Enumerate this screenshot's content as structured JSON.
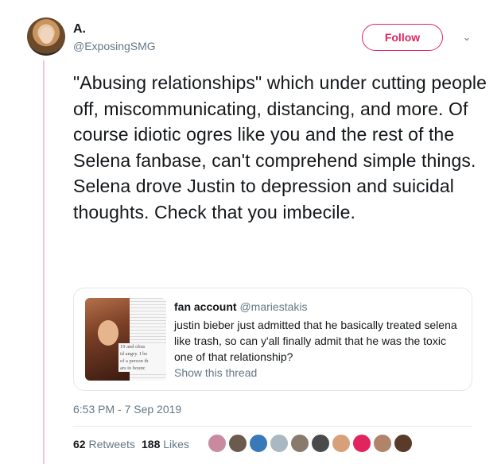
{
  "author": {
    "display_name": "A.",
    "handle": "@ExposingSMG"
  },
  "follow_button": "Follow",
  "tweet_text": "\"Abusing relationships\" which under cutting people off, miscommunicating, distancing, and more. Of course idiotic ogres like you and the rest of the Selena fanbase, can't comprehend simple things. Selena drove Justin to depression and suicidal thoughts. Check that you imbecile.",
  "quoted_tweet": {
    "author_name": "fan account",
    "author_handle": "@mariestakis",
    "text": "justin bieber just admitted that he basically treated selena like trash, so can y'all finally admit that he was the toxic one of that relationship?",
    "show_thread": "Show this thread",
    "image_text": "19 and obus\nid angry. I be\nof a person th\nars to bounc"
  },
  "timestamp": "6:53 PM - 7 Sep 2019",
  "stats": {
    "retweets_count": "62",
    "retweets_label": "Retweets",
    "likes_count": "188",
    "likes_label": "Likes"
  },
  "likers": [
    {
      "name": "liker-1",
      "color": "#c98aa0"
    },
    {
      "name": "liker-2",
      "color": "#6b5a4e"
    },
    {
      "name": "liker-3",
      "color": "#3a79b8"
    },
    {
      "name": "liker-4",
      "color": "#aab8c2"
    },
    {
      "name": "liker-5",
      "color": "#8a7a6c"
    },
    {
      "name": "liker-6",
      "color": "#4a4a4a"
    },
    {
      "name": "liker-7",
      "color": "#d8a07a"
    },
    {
      "name": "liker-8",
      "color": "#e0245e"
    },
    {
      "name": "liker-9",
      "color": "#b0846a"
    },
    {
      "name": "liker-10",
      "color": "#5a3a2a"
    }
  ],
  "colors": {
    "accent": "#e0245e",
    "thread_line": "#f4c6cf",
    "secondary_text": "#657786"
  }
}
